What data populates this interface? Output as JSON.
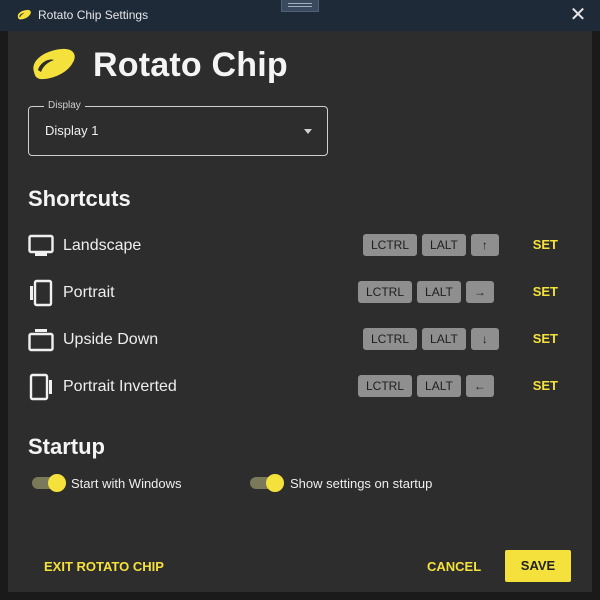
{
  "window": {
    "title": "Rotato Chip Settings",
    "close_label": "✕"
  },
  "header": {
    "app_name": "Rotato Chip"
  },
  "display": {
    "legend": "Display",
    "value": "Display 1"
  },
  "shortcuts": {
    "title": "Shortcuts",
    "set_label": "SET",
    "items": [
      {
        "icon": "monitor-landscape-icon",
        "label": "Landscape",
        "keys": [
          "LCTRL",
          "LALT",
          "↑"
        ]
      },
      {
        "icon": "monitor-portrait-icon",
        "label": "Portrait",
        "keys": [
          "LCTRL",
          "LALT",
          "→"
        ]
      },
      {
        "icon": "monitor-upside-down-icon",
        "label": "Upside Down",
        "keys": [
          "LCTRL",
          "LALT",
          "↓"
        ]
      },
      {
        "icon": "monitor-portrait-inverted-icon",
        "label": "Portrait Inverted",
        "keys": [
          "LCTRL",
          "LALT",
          "←"
        ]
      }
    ]
  },
  "startup": {
    "title": "Startup",
    "start_with_windows": {
      "label": "Start with Windows",
      "checked": true
    },
    "show_settings": {
      "label": "Show settings on startup",
      "checked": true
    }
  },
  "footer": {
    "exit_label": "EXIT ROTATO CHIP",
    "cancel_label": "CANCEL",
    "save_label": "SAVE"
  },
  "colors": {
    "accent": "#f5e13b",
    "background": "#2d2d2d",
    "titlebar": "#1e2a38",
    "key_chip": "#8f8f8f"
  }
}
